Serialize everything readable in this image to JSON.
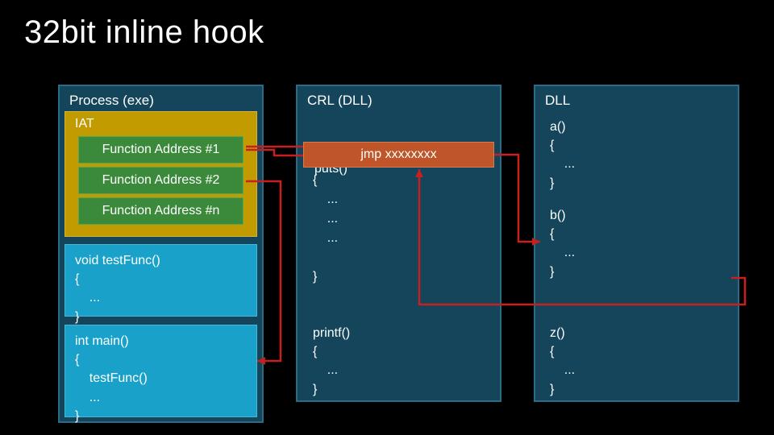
{
  "title": "32bit inline hook",
  "process": {
    "panel_title": "Process (exe)",
    "iat_title": "IAT",
    "functions": [
      "Function Address #1",
      "Function Address #2",
      "Function Address #n"
    ],
    "testFunc": "void testFunc()\n{\n    ...\n}",
    "main": "int main()\n{\n    testFunc()\n    ...\n}"
  },
  "crl": {
    "panel_title": "CRL (DLL)",
    "puts_label": "puts()",
    "jmp_label": "jmp xxxxxxxx",
    "puts_body": "{\n    ...\n    ...\n    ...\n\n}",
    "printf": "printf()\n{\n    ...\n}"
  },
  "dll": {
    "panel_title": "DLL",
    "a": "a()\n{\n    ...\n}",
    "b": "b()\n{\n    ...\n}",
    "z": "z()\n{\n    ...\n}"
  },
  "colors": {
    "panel_bg": "#15455b",
    "panel_border": "#2a6c86",
    "iat_bg": "#c19b00",
    "fn_bg": "#3b8a3b",
    "code_bg": "#1aa1c9",
    "jmp_bg": "#c0552a",
    "arrow": "#c62020"
  }
}
